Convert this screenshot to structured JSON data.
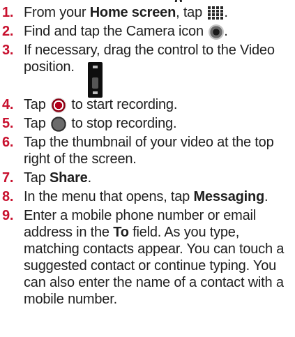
{
  "header_fragment": "g",
  "steps": [
    {
      "num": "1.",
      "parts": [
        "From your ",
        "Home screen",
        ", tap ",
        "."
      ]
    },
    {
      "num": "2.",
      "parts": [
        "Find and tap the Camera icon ",
        "."
      ]
    },
    {
      "num": "3.",
      "parts": [
        "If necessary, drag the control to the Video",
        "position."
      ]
    },
    {
      "num": "4.",
      "parts": [
        "Tap ",
        " to start recording."
      ]
    },
    {
      "num": "5.",
      "parts": [
        "Tap ",
        " to stop recording."
      ]
    },
    {
      "num": "6.",
      "parts": [
        "Tap the thumbnail of your video at the top right of the screen."
      ]
    },
    {
      "num": "7.",
      "parts": [
        "Tap ",
        "Share",
        "."
      ]
    },
    {
      "num": "8.",
      "parts": [
        "In the menu that opens, tap ",
        "Messaging",
        "."
      ]
    },
    {
      "num": "9.",
      "parts": [
        "Enter a mobile phone number or email address in the ",
        "To",
        " field. As you type, matching contacts appear. You can touch a suggested contact or continue typing. You can also enter the name of a contact with a mobile number."
      ]
    }
  ],
  "icons": [
    "apps-grid-icon",
    "camera-icon",
    "video-switch-icon",
    "record-icon",
    "stop-icon"
  ]
}
